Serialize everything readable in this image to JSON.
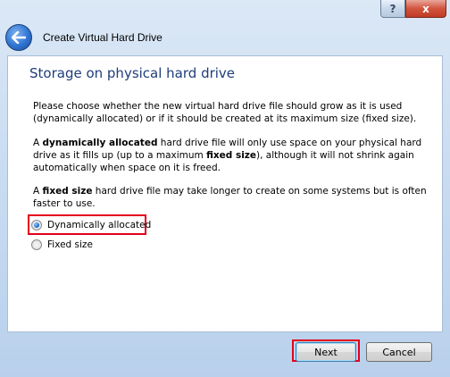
{
  "window": {
    "title": "Create Virtual Hard Drive",
    "help_glyph": "?",
    "close_glyph": "x"
  },
  "page": {
    "heading": "Storage on physical hard drive",
    "paragraph1": "Please choose whether the new virtual hard drive file should grow as it is used (dynamically allocated) or if it should be created at its maximum size (fixed size).",
    "paragraph2": {
      "prefix": "A ",
      "bold1": "dynamically allocated",
      "mid": " hard drive file will only use space on your physical hard drive as it fills up (up to a maximum ",
      "bold2": "fixed size",
      "suffix": "), although it will not shrink again automatically when space on it is freed."
    },
    "paragraph3": {
      "prefix": "A ",
      "bold": "fixed size",
      "suffix": " hard drive file may take longer to create on some systems but is often faster to use."
    },
    "options": [
      {
        "label": "Dynamically allocated",
        "selected": true
      },
      {
        "label": "Fixed size",
        "selected": false
      }
    ]
  },
  "buttons": {
    "next": "Next",
    "cancel": "Cancel"
  },
  "colors": {
    "heading": "#1f3d7a",
    "highlight": "#e3001b"
  }
}
